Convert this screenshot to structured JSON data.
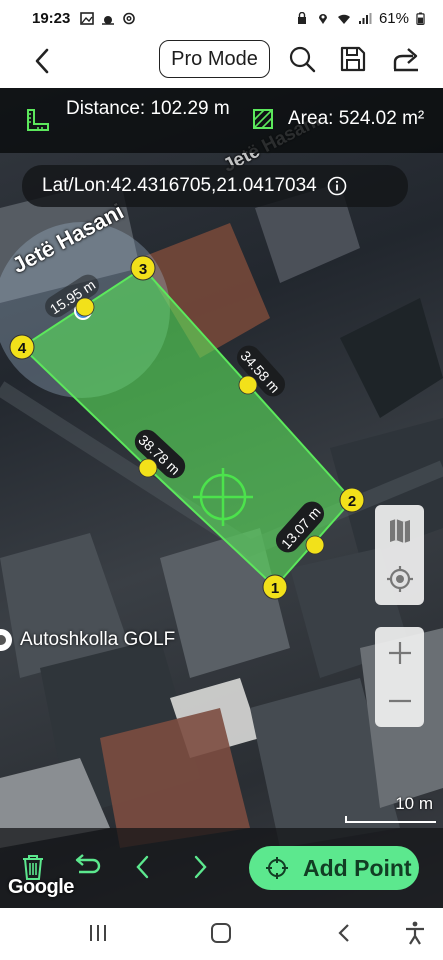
{
  "status_bar": {
    "time": "19:23",
    "battery": "61%",
    "notification_icons": [
      "image-icon",
      "weather-icon",
      "threads-icon"
    ],
    "system_icons": [
      "lock-icon",
      "location-icon",
      "wifi-icon",
      "signal-icon",
      "battery-icon"
    ]
  },
  "app_bar": {
    "pro_mode_label": "Pro Mode",
    "icons": [
      "back-icon",
      "search-icon",
      "save-icon",
      "share-icon"
    ]
  },
  "measurements": {
    "distance_label": "Distance: 102.29 m",
    "area_label": "Area: 524.02 m²"
  },
  "coordinates": {
    "text": "Lat/Lon:42.4316705,21.0417034"
  },
  "map": {
    "street_name": "Jetë Hasani",
    "poi_name": "Autoshkolla GOLF",
    "scale_label": "10 m",
    "google_label": "Google",
    "polygon": {
      "fill_color": "#5ce85c",
      "point_labels": [
        "1",
        "2",
        "3",
        "4"
      ],
      "segment_lengths": [
        "13.07 m",
        "34.58 m",
        "15.95 m",
        "38.78 m"
      ]
    }
  },
  "side_controls": [
    "map-layers-icon",
    "my-location-icon",
    "zoom-in-icon",
    "zoom-out-icon"
  ],
  "bottom_bar": {
    "add_point_label": "Add Point",
    "icons": [
      "delete-icon",
      "undo-icon",
      "previous-icon",
      "next-icon"
    ]
  },
  "nav_bar": [
    "recents-icon",
    "home-icon",
    "back-nav-icon",
    "accessibility-icon"
  ],
  "colors": {
    "accent_green": "#5ce88e",
    "vertex_yellow": "#f2e11a",
    "info_bar": "#0a0c0e"
  }
}
